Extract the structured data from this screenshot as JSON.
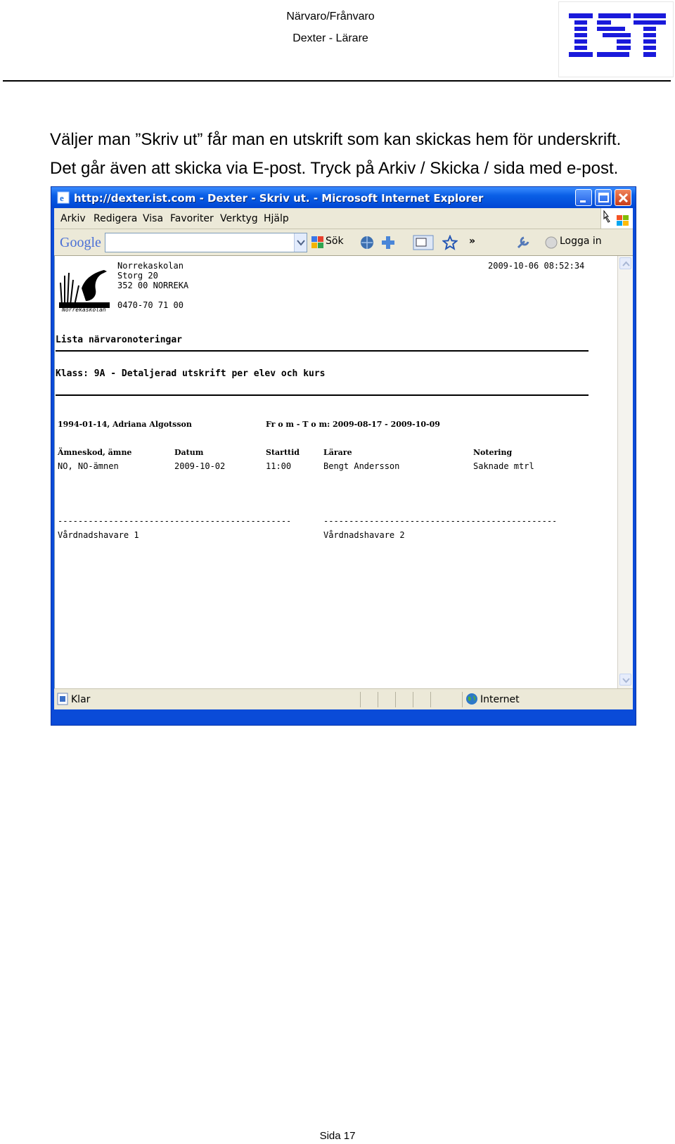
{
  "header": {
    "line1": "Närvaro/Frånvaro",
    "line2": "Dexter - Lärare",
    "logo_text": "IST",
    "logo_color": "#1a1adb"
  },
  "intro": {
    "line1": "Väljer man ”Skriv ut” får man en utskrift som kan skickas hem för underskrift.",
    "line2": "Det går även att skicka via E-post. Tryck på Arkiv / Skicka / sida med e-post."
  },
  "browser": {
    "title": "http://dexter.ist.com - Dexter - Skriv ut. - Microsoft Internet Explorer",
    "menu": [
      "Arkiv",
      "Redigera",
      "Visa",
      "Favoriter",
      "Verktyg",
      "Hjälp"
    ],
    "google_logo": "Google",
    "search_button": "Sök",
    "overflow": "»",
    "login": "Logga in",
    "status": "Klar",
    "zone": "Internet",
    "accent": "#0a4bd8"
  },
  "report": {
    "logo_caption": "Norrekaskolan",
    "school_name": "Norrekaskolan",
    "street": "Storg 20",
    "postal": "352 00 NORREKA",
    "phone": "0470-70 71 00",
    "timestamp": "2009-10-06 08:52:34",
    "list_title": "Lista närvaronoteringar",
    "class_title": "Klass: 9A - Detaljerad utskrift per elev och kurs",
    "student": "1994-01-14, Adriana Algotsson",
    "period": "Fr o m - T o m: 2009-08-17 - 2009-10-09",
    "columns": [
      "Ämneskod, ämne",
      "Datum",
      "Starttid",
      "Lärare",
      "Notering"
    ],
    "rows": [
      [
        "NO, NO-ämnen",
        "2009-10-02",
        "11:00",
        "Bengt Andersson",
        "Saknade mtrl"
      ]
    ],
    "signature_line": "-------------------------------------------------------",
    "guardian1": "Vårdnadshavare 1",
    "guardian2": "Vårdnadshavare 2"
  },
  "footer": "Sida 17"
}
